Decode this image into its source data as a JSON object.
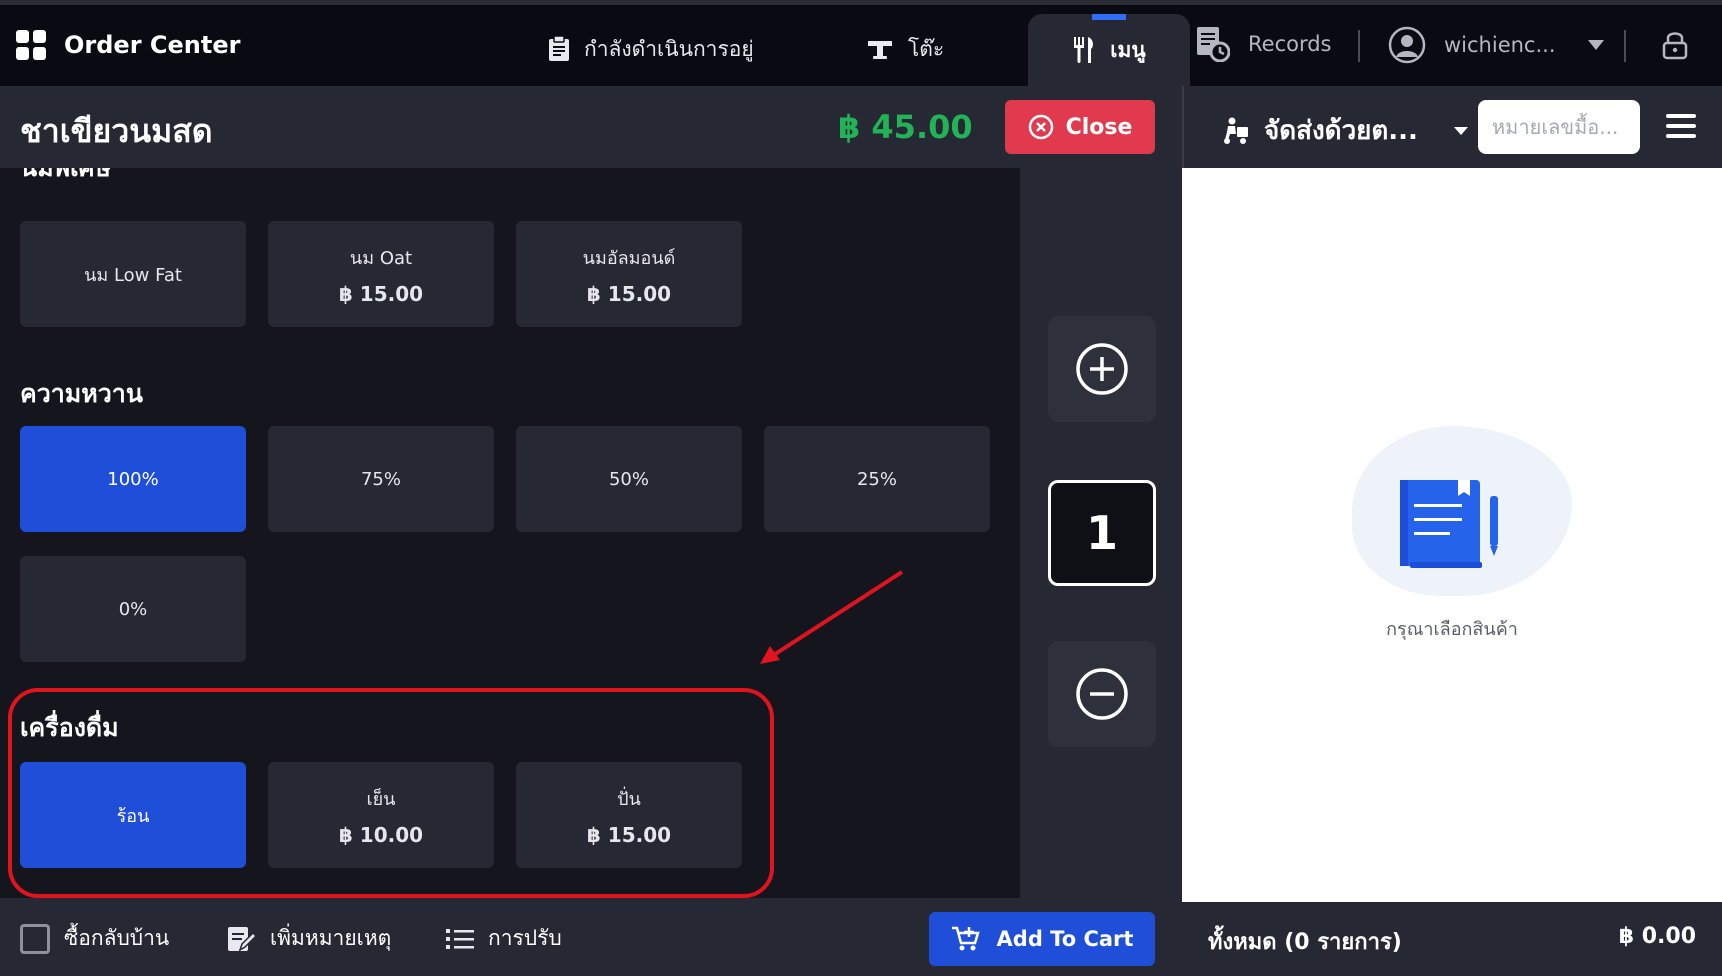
{
  "app": {
    "title": "Order Center"
  },
  "nav": {
    "in_progress": "กำลังดำเนินการอยู่",
    "table": "โต๊ะ",
    "menu": "เมนู",
    "records": "Records",
    "user": "wichienc..."
  },
  "item": {
    "name": "ชาเขียวนมสด",
    "price": "฿ 45.00",
    "close_label": "Close"
  },
  "order": {
    "delivery": "จัดส่งด้วยต...",
    "number_placeholder": "หมายเลขมื้อ..."
  },
  "milk": {
    "options": [
      {
        "label": "นม Low Fat",
        "price": ""
      },
      {
        "label": "นม Oat",
        "price": "฿ 15.00"
      },
      {
        "label": "นมอัลมอนด์",
        "price": "฿ 15.00"
      }
    ]
  },
  "sweetness": {
    "title": "ความหวาน",
    "selected": "100%",
    "options": [
      {
        "label": "100%"
      },
      {
        "label": "75%"
      },
      {
        "label": "50%"
      },
      {
        "label": "25%"
      },
      {
        "label": "0%"
      }
    ]
  },
  "drink": {
    "title": "เครื่องดื่ม",
    "selected": "ร้อน",
    "options": [
      {
        "label": "ร้อน",
        "price": ""
      },
      {
        "label": "เย็น",
        "price": "฿ 10.00"
      },
      {
        "label": "ปั่น",
        "price": "฿ 15.00"
      }
    ]
  },
  "quantity": {
    "value": "1"
  },
  "cart": {
    "empty_text": "กรุณาเลือกสินค้า",
    "total_label": "ทั้งหมด (0 รายการ)",
    "total_value": "฿ 0.00"
  },
  "footer": {
    "takeaway": "ซื้อกลับบ้าน",
    "add_note": "เพิ่มหมายเหตุ",
    "adjust": "การปรับ",
    "add_to_cart": "Add To Cart"
  },
  "colors": {
    "accent": "#1f4fd8",
    "price": "#22b357",
    "close": "#e13a4e",
    "annotation": "#e0141e"
  }
}
